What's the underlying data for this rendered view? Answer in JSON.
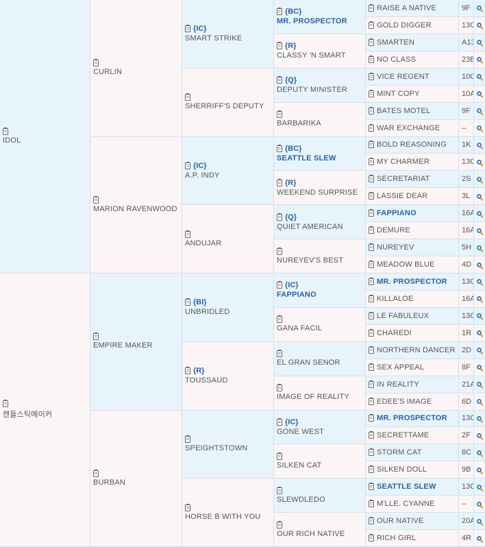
{
  "gen1": [
    {
      "name": "IDOL",
      "code": "",
      "hl": false,
      "bg": "blue"
    },
    {
      "name": "캔들스틱메이커",
      "code": "",
      "hl": false,
      "bg": "pink"
    }
  ],
  "gen2": [
    {
      "name": "CURLIN",
      "code": "",
      "hl": false,
      "bg": "pink"
    },
    {
      "name": "MARION RAVENWOOD",
      "code": "",
      "hl": false,
      "bg": "pink"
    },
    {
      "name": "EMPIRE MAKER",
      "code": "",
      "hl": false,
      "bg": "blue"
    },
    {
      "name": "BURBAN",
      "code": "",
      "hl": false,
      "bg": "pink"
    }
  ],
  "gen3": [
    {
      "name": "SMART STRIKE",
      "code": "{IC}",
      "hl": false,
      "bg": "blue"
    },
    {
      "name": "SHERRIFF'S DEPUTY",
      "code": "",
      "hl": false,
      "bg": "pink"
    },
    {
      "name": "A.P. INDY",
      "code": "{IC}",
      "hl": false,
      "bg": "blue"
    },
    {
      "name": "ANDUJAR",
      "code": "",
      "hl": false,
      "bg": "pink"
    },
    {
      "name": "UNBRIDLED",
      "code": "{BI}",
      "hl": false,
      "bg": "blue"
    },
    {
      "name": "TOUSSAUD",
      "code": "{R}",
      "hl": false,
      "bg": "pink"
    },
    {
      "name": "SPEIGHTSTOWN",
      "code": "",
      "hl": false,
      "bg": "blue"
    },
    {
      "name": "HORSE B WITH YOU",
      "code": "",
      "hl": false,
      "bg": "pink"
    }
  ],
  "gen4": [
    {
      "name": "MR. PROSPECTOR",
      "code": "{BC}",
      "hl": true,
      "bg": "blue"
    },
    {
      "name": "CLASSY 'N SMART",
      "code": "{R}",
      "hl": false,
      "bg": "pink"
    },
    {
      "name": "DEPUTY MINISTER",
      "code": "{Q}",
      "hl": false,
      "bg": "blue"
    },
    {
      "name": "BARBARIKA",
      "code": "",
      "hl": false,
      "bg": "pink"
    },
    {
      "name": "SEATTLE SLEW",
      "code": "{BC}",
      "hl": true,
      "bg": "blue"
    },
    {
      "name": "WEEKEND SURPRISE",
      "code": "{R}",
      "hl": false,
      "bg": "pink"
    },
    {
      "name": "QUIET AMERICAN",
      "code": "{Q}",
      "hl": false,
      "bg": "blue"
    },
    {
      "name": "NUREYEV'S BEST",
      "code": "",
      "hl": false,
      "bg": "pink"
    },
    {
      "name": "FAPPIANO",
      "code": "{IC}",
      "hl": true,
      "bg": "blue"
    },
    {
      "name": "GANA FACIL",
      "code": "",
      "hl": false,
      "bg": "pink"
    },
    {
      "name": "EL GRAN SENOR",
      "code": "",
      "hl": false,
      "bg": "blue"
    },
    {
      "name": "IMAGE OF REALITY",
      "code": "",
      "hl": false,
      "bg": "pink"
    },
    {
      "name": "GONE WEST",
      "code": "{IC}",
      "hl": false,
      "bg": "blue"
    },
    {
      "name": "SILKEN CAT",
      "code": "",
      "hl": false,
      "bg": "pink"
    },
    {
      "name": "SLEWDLEDO",
      "code": "",
      "hl": false,
      "bg": "blue"
    },
    {
      "name": "OUR RICH NATIVE",
      "code": "",
      "hl": false,
      "bg": "pink"
    }
  ],
  "gen5": [
    {
      "name": "RAISE A NATIVE",
      "num": "9F",
      "hl": false,
      "bg": "blue"
    },
    {
      "name": "GOLD DIGGER",
      "num": "13C",
      "hl": false,
      "bg": "pink"
    },
    {
      "name": "SMARTEN",
      "num": "A13",
      "hl": false,
      "bg": "blue"
    },
    {
      "name": "NO CLASS",
      "num": "23B",
      "hl": false,
      "bg": "pink"
    },
    {
      "name": "VICE REGENT",
      "num": "10C",
      "hl": false,
      "bg": "blue"
    },
    {
      "name": "MINT COPY",
      "num": "10A",
      "hl": false,
      "bg": "pink"
    },
    {
      "name": "BATES MOTEL",
      "num": "9F",
      "hl": false,
      "bg": "blue"
    },
    {
      "name": "WAR EXCHANGE",
      "num": "–",
      "hl": false,
      "bg": "pink"
    },
    {
      "name": "BOLD REASONING",
      "num": "1K",
      "hl": false,
      "bg": "blue"
    },
    {
      "name": "MY CHARMER",
      "num": "13C",
      "hl": false,
      "bg": "pink"
    },
    {
      "name": "SECRETARIAT",
      "num": "2S",
      "hl": false,
      "bg": "blue"
    },
    {
      "name": "LASSIE DEAR",
      "num": "3L",
      "hl": false,
      "bg": "pink"
    },
    {
      "name": "FAPPIANO",
      "num": "16A",
      "hl": true,
      "bg": "blue"
    },
    {
      "name": "DEMURE",
      "num": "16A",
      "hl": false,
      "bg": "pink"
    },
    {
      "name": "NUREYEV",
      "num": "5H",
      "hl": false,
      "bg": "blue"
    },
    {
      "name": "MEADOW BLUE",
      "num": "4D",
      "hl": false,
      "bg": "pink"
    },
    {
      "name": "MR. PROSPECTOR",
      "num": "13C",
      "hl": true,
      "bg": "blue"
    },
    {
      "name": "KILLALOE",
      "num": "16A",
      "hl": false,
      "bg": "pink"
    },
    {
      "name": "LE FABULEUX",
      "num": "13C",
      "hl": false,
      "bg": "blue"
    },
    {
      "name": "CHAREDI",
      "num": "1R",
      "hl": false,
      "bg": "pink"
    },
    {
      "name": "NORTHERN DANCER",
      "num": "2D",
      "hl": false,
      "bg": "blue"
    },
    {
      "name": "SEX APPEAL",
      "num": "8F",
      "hl": false,
      "bg": "pink"
    },
    {
      "name": "IN REALITY",
      "num": "21A",
      "hl": false,
      "bg": "blue"
    },
    {
      "name": "EDEE'S IMAGE",
      "num": "6D",
      "hl": false,
      "bg": "pink"
    },
    {
      "name": "MR. PROSPECTOR",
      "num": "13C",
      "hl": true,
      "bg": "blue"
    },
    {
      "name": "SECRETTAME",
      "num": "2F",
      "hl": false,
      "bg": "pink"
    },
    {
      "name": "STORM CAT",
      "num": "8C",
      "hl": false,
      "bg": "blue"
    },
    {
      "name": "SILKEN DOLL",
      "num": "9B",
      "hl": false,
      "bg": "pink"
    },
    {
      "name": "SEATTLE SLEW",
      "num": "13C",
      "hl": true,
      "bg": "blue"
    },
    {
      "name": "M'LLE. CYANNE",
      "num": "–",
      "hl": false,
      "bg": "pink"
    },
    {
      "name": "OUR NATIVE",
      "num": "20A",
      "hl": false,
      "bg": "blue"
    },
    {
      "name": "RICH GIRL",
      "num": "4R",
      "hl": false,
      "bg": "pink"
    }
  ]
}
